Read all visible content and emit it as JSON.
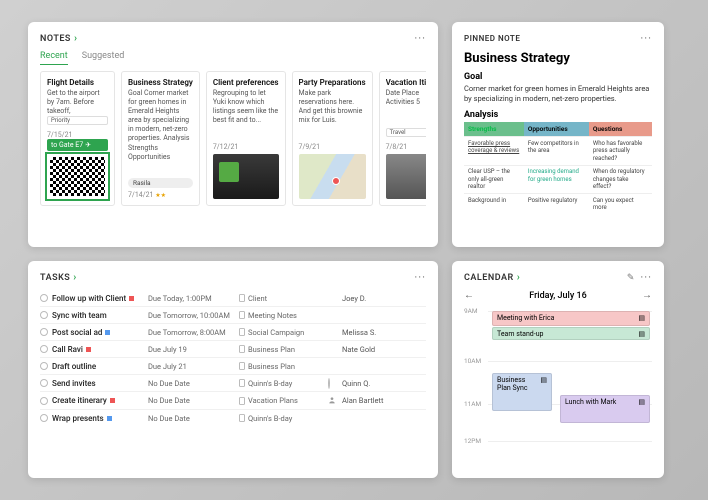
{
  "notes": {
    "title": "NOTES",
    "tabs": {
      "recent": "Recent",
      "suggested": "Suggested"
    },
    "cards": [
      {
        "title": "Flight Details",
        "body": "Get to the airport by 7am. Before takeoff,",
        "date": "7/15/21",
        "tag": "Priority",
        "gate": "to Gate E7"
      },
      {
        "title": "Business Strategy",
        "body": "Goal Corner market for green homes in Emerald Heights area by specializing in modern, net-zero properties. Analysis Strengths Opportunities",
        "date": "7/14/21",
        "user": "Rasila"
      },
      {
        "title": "Client preferences",
        "body": "Regrouping to let Yuki know which listings seem like the best fit and to...",
        "date": "7/12/21"
      },
      {
        "title": "Party Preparations",
        "body": "Make park reservations here. And get this brownie mix for Luis.",
        "date": "7/9/21"
      },
      {
        "title": "Vacation Iti",
        "body": "Date Place Activities 5",
        "date": "7/8/21",
        "tag": "Travel"
      }
    ]
  },
  "pinned": {
    "label": "PINNED NOTE",
    "title": "Business Strategy",
    "goal_h": "Goal",
    "goal": "Corner market for green homes in Emerald Heights area by specializing in modern, net-zero properties.",
    "analysis_h": "Analysis",
    "cols": {
      "s": "Strengths",
      "o": "Opportunities",
      "q": "Questions"
    },
    "rows": [
      {
        "s": "Favorable press coverage & reviews",
        "o": "Few competitors in the area",
        "q": "Who has favorable press actually reached?"
      },
      {
        "s": "Clear USP – the only all-green realtor",
        "o": "Increasing demand for green homes",
        "q": "When do regulatory changes take effect?"
      },
      {
        "s": "Background in",
        "o": "Positive regulatory",
        "q": "Can you expect more"
      }
    ]
  },
  "tasks": {
    "title": "TASKS",
    "items": [
      {
        "name": "Follow up with Client",
        "flag": "red",
        "due": "Due Today, 1:00PM",
        "ref": "Client",
        "assignee": "Joey D.",
        "av": "j"
      },
      {
        "name": "Sync with team",
        "due": "Due Tomorrow, 10:00AM",
        "ref": "Meeting Notes"
      },
      {
        "name": "Post social ad",
        "flag": "blue",
        "due": "Due Tomorrow, 8:00AM",
        "ref": "Social Campaign",
        "assignee": "Melissa S.",
        "av": "m"
      },
      {
        "name": "Call Ravi",
        "flag": "red",
        "due": "Due July 19",
        "ref": "Business Plan",
        "assignee": "Nate Gold",
        "av": "n"
      },
      {
        "name": "Draft outline",
        "due": "Due July 21",
        "ref": "Business Plan"
      },
      {
        "name": "Send invites",
        "due": "No Due Date",
        "ref": "Quinn's B-day",
        "assignee": "Quinn Q.",
        "ring": true
      },
      {
        "name": "Create itinerary",
        "flag": "red",
        "due": "No Due Date",
        "ref": "Vacation Plans",
        "assignee": "Alan Bartlett"
      },
      {
        "name": "Wrap presents",
        "flag": "blue",
        "due": "No Due Date",
        "ref": "Quinn's B-day"
      }
    ]
  },
  "calendar": {
    "title": "CALENDAR",
    "date": "Friday, July 16",
    "hours": [
      "9AM",
      "10AM",
      "11AM",
      "12PM"
    ],
    "events": {
      "e1": "Meeting with Erica",
      "e2": "Team stand-up",
      "e3": "Business Plan Sync",
      "e4": "Lunch with Mark"
    }
  }
}
